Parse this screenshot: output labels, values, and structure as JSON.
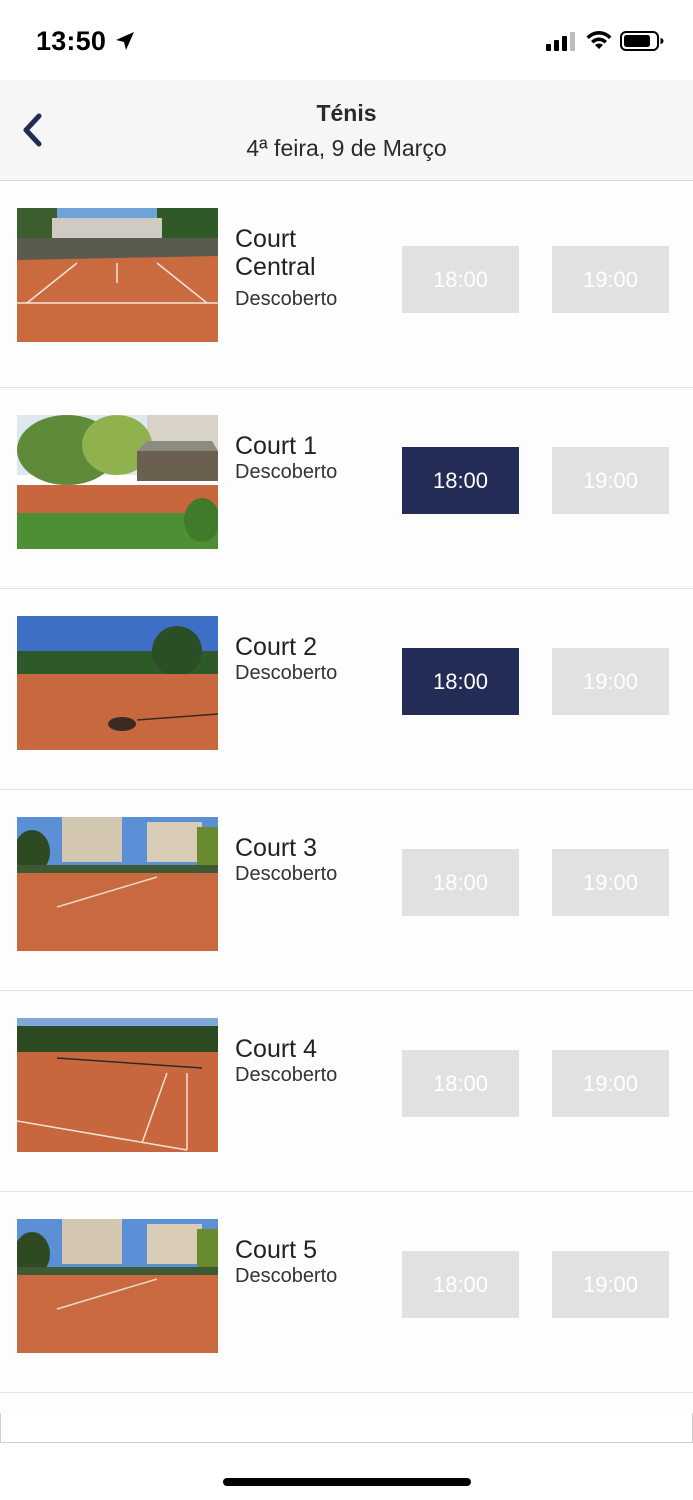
{
  "status_bar": {
    "time": "13:50"
  },
  "header": {
    "title": "Ténis",
    "subtitle": "4ª feira, 9 de Março"
  },
  "colors": {
    "available_slot": "#232c56",
    "unavailable_slot": "#e1e1e1",
    "header_bg": "#f6f6f6"
  },
  "courts": [
    {
      "name": "Court Central",
      "cover": "Descoberto",
      "slots": [
        {
          "time": "18:00",
          "available": false
        },
        {
          "time": "19:00",
          "available": false
        }
      ]
    },
    {
      "name": "Court 1",
      "cover": "Descoberto",
      "slots": [
        {
          "time": "18:00",
          "available": true
        },
        {
          "time": "19:00",
          "available": false
        }
      ]
    },
    {
      "name": "Court 2",
      "cover": "Descoberto",
      "slots": [
        {
          "time": "18:00",
          "available": true
        },
        {
          "time": "19:00",
          "available": false
        }
      ]
    },
    {
      "name": "Court 3",
      "cover": "Descoberto",
      "slots": [
        {
          "time": "18:00",
          "available": false
        },
        {
          "time": "19:00",
          "available": false
        }
      ]
    },
    {
      "name": "Court 4",
      "cover": "Descoberto",
      "slots": [
        {
          "time": "18:00",
          "available": false
        },
        {
          "time": "19:00",
          "available": false
        }
      ]
    },
    {
      "name": "Court 5",
      "cover": "Descoberto",
      "slots": [
        {
          "time": "18:00",
          "available": false
        },
        {
          "time": "19:00",
          "available": false
        }
      ]
    }
  ]
}
